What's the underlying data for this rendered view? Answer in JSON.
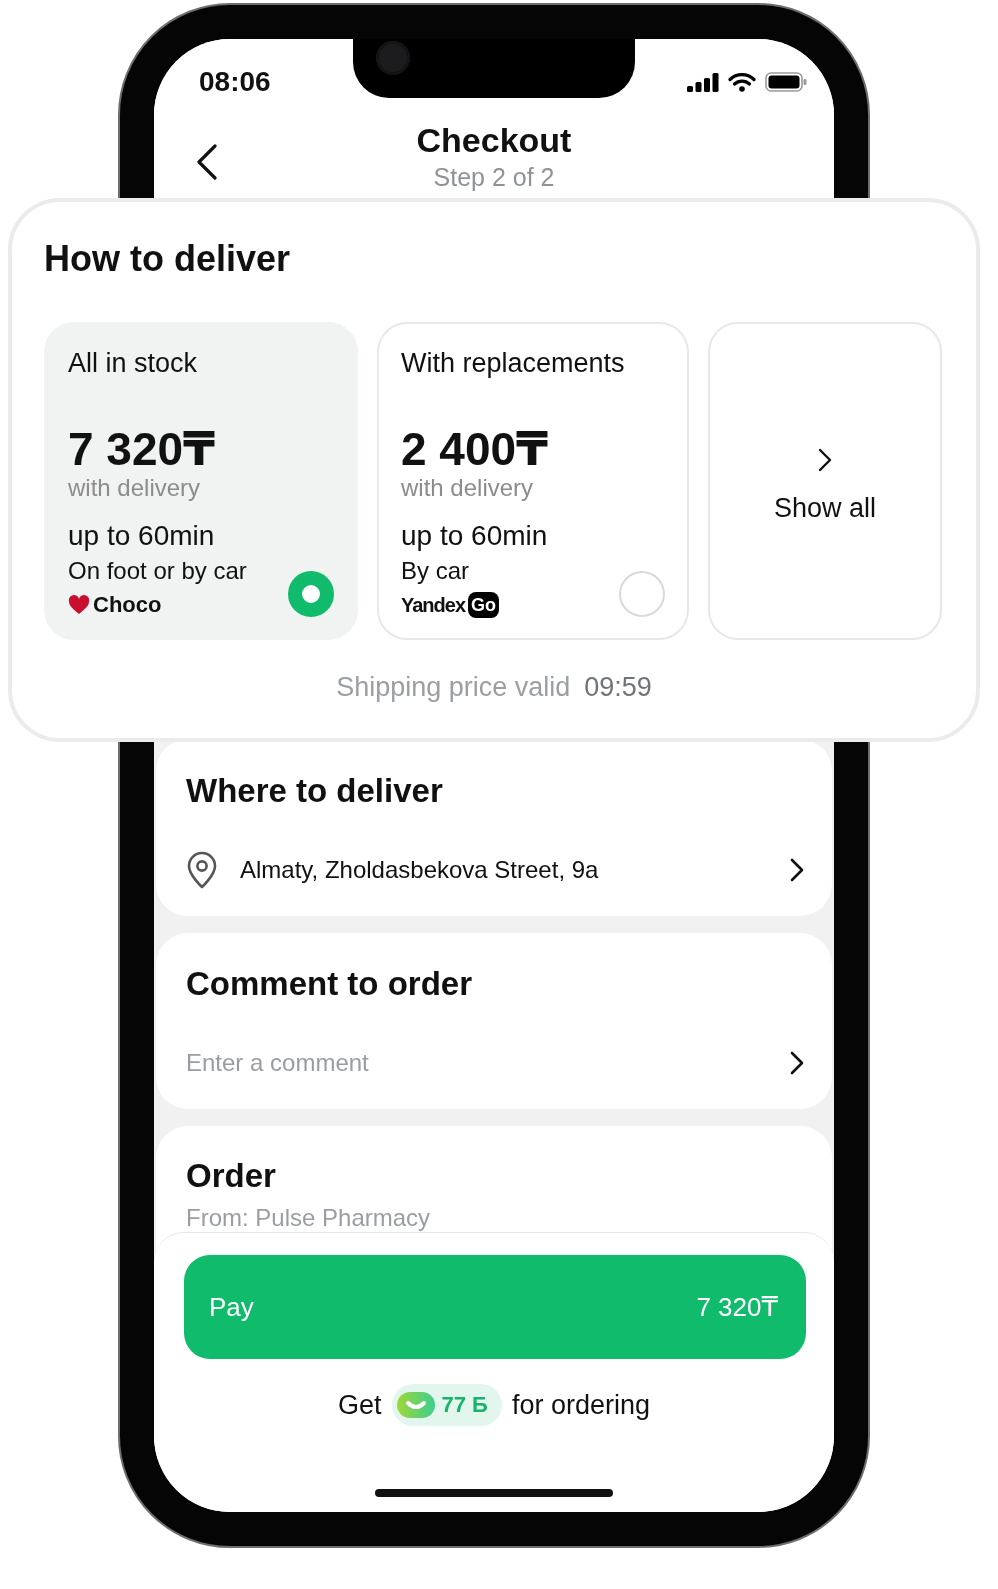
{
  "status_bar": {
    "time": "08:06"
  },
  "header": {
    "title": "Checkout",
    "subtitle": "Step 2 of 2"
  },
  "delivery": {
    "title": "How to deliver",
    "options": [
      {
        "title": "All in stock",
        "price": "7 320₸",
        "price_note": "with delivery",
        "eta": "up to 60min",
        "method": "On foot or by car",
        "provider": {
          "kind": "heart",
          "name": "Choco"
        },
        "selected": true
      },
      {
        "title": "With replacements",
        "price": "2 400₸",
        "price_note": "with delivery",
        "eta": "up to 60min",
        "method": "By car",
        "provider": {
          "kind": "tile",
          "name": "Yandex",
          "badge": "Go"
        },
        "selected": false
      }
    ],
    "show_all": "Show all",
    "validity": {
      "label": "Shipping price valid",
      "timer": "09:59"
    }
  },
  "address": {
    "title": "Where to deliver",
    "value": "Almaty, Zholdasbekova Street, 9a"
  },
  "comment": {
    "title": "Comment to order",
    "placeholder": "Enter a comment"
  },
  "order": {
    "title": "Order",
    "source": "From: Pulse Pharmacy"
  },
  "pay_button": {
    "label": "Pay",
    "amount": "7 320₸"
  },
  "bonus": {
    "prefix": "Get",
    "points": "77 Б",
    "suffix": "for ordering"
  }
}
